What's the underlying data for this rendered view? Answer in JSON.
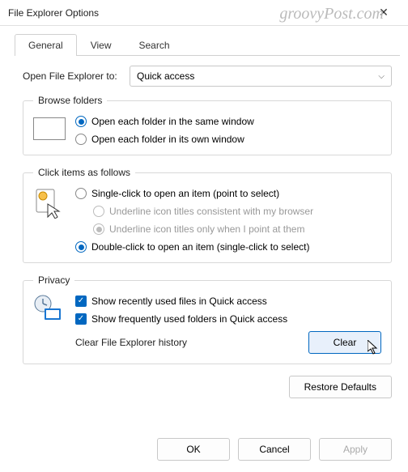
{
  "window": {
    "title": "File Explorer Options"
  },
  "watermark": "groovyPost.com",
  "tabs": {
    "general": "General",
    "view": "View",
    "search": "Search",
    "active": "General"
  },
  "open_to": {
    "label": "Open File Explorer to:",
    "value": "Quick access"
  },
  "browse": {
    "legend": "Browse folders",
    "opt_same": "Open each folder in the same window",
    "opt_own": "Open each folder in its own window",
    "selected": "same"
  },
  "click": {
    "legend": "Click items as follows",
    "single": "Single-click to open an item (point to select)",
    "u_browser": "Underline icon titles consistent with my browser",
    "u_point": "Underline icon titles only when I point at them",
    "double": "Double-click to open an item (single-click to select)",
    "selected": "double",
    "underline_selected": "point"
  },
  "privacy": {
    "legend": "Privacy",
    "recent_files": "Show recently used files in Quick access",
    "recent_files_checked": true,
    "frequent_folders": "Show frequently used folders in Quick access",
    "frequent_folders_checked": true,
    "clear_label": "Clear File Explorer history",
    "clear_button": "Clear"
  },
  "restore": "Restore Defaults",
  "footer": {
    "ok": "OK",
    "cancel": "Cancel",
    "apply": "Apply"
  }
}
